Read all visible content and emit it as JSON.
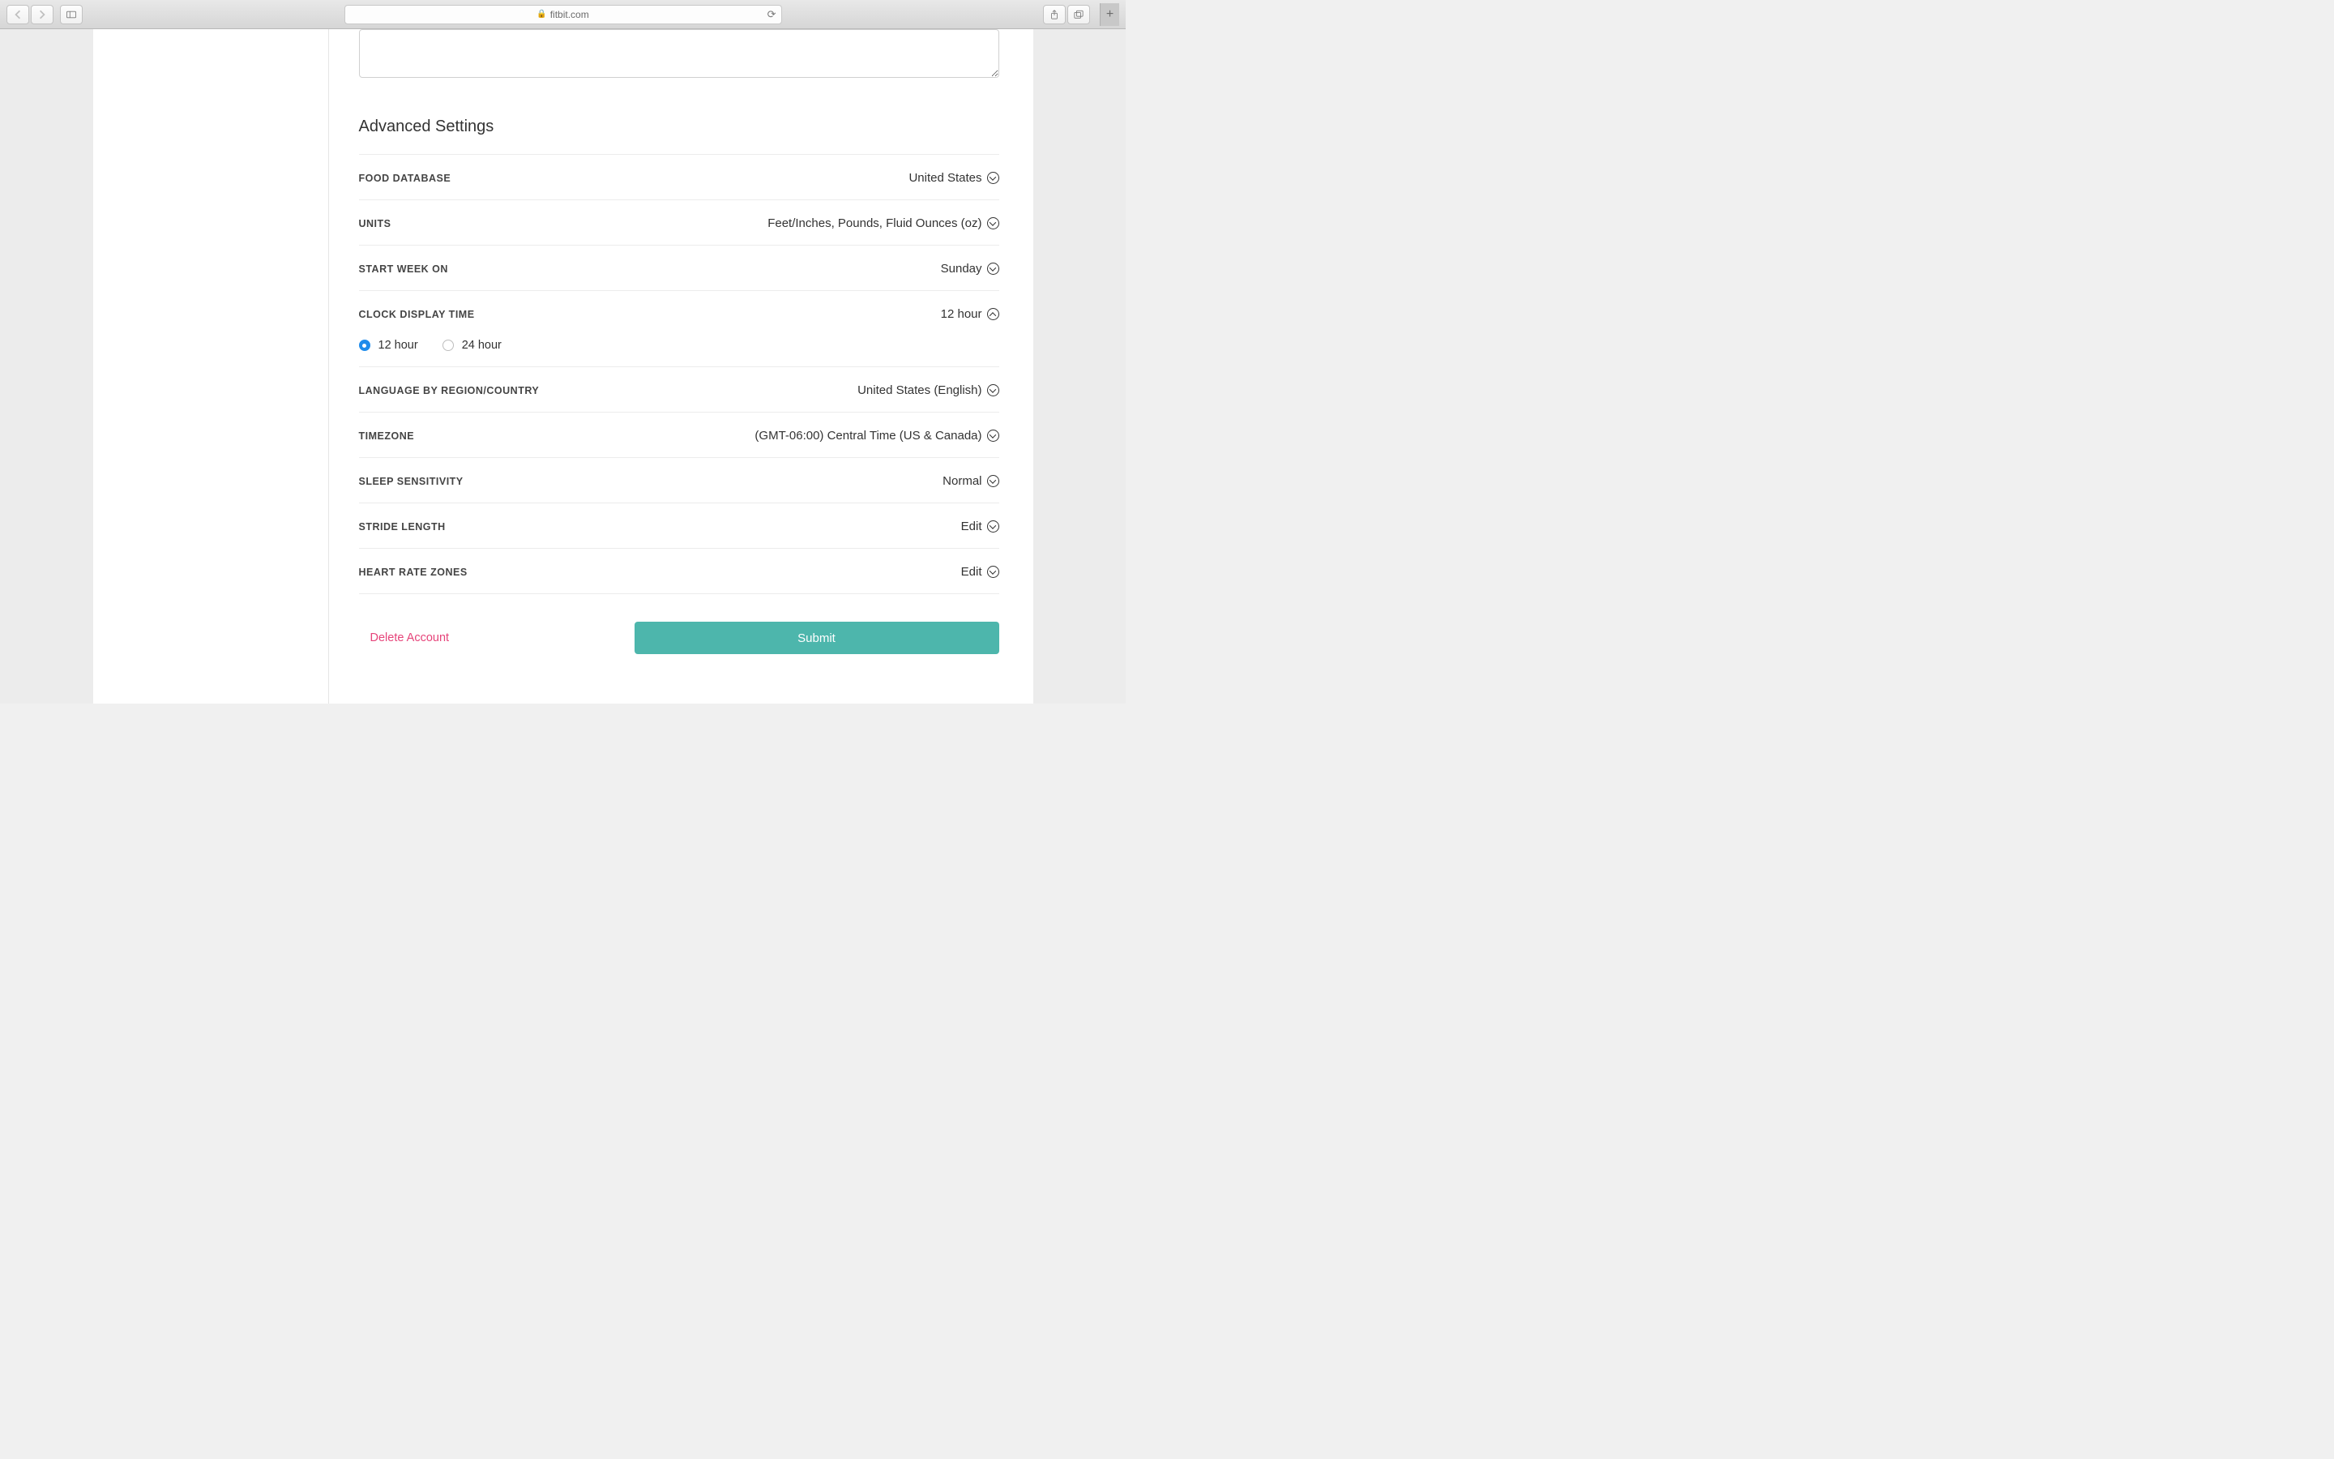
{
  "browser": {
    "url_host": "fitbit.com"
  },
  "settings": {
    "section_title": "Advanced Settings",
    "rows": {
      "food_db": {
        "label": "FOOD DATABASE",
        "value": "United States"
      },
      "units": {
        "label": "UNITS",
        "value": "Feet/Inches, Pounds, Fluid Ounces (oz)"
      },
      "start_week": {
        "label": "START WEEK ON",
        "value": "Sunday"
      },
      "clock": {
        "label": "CLOCK DISPLAY TIME",
        "value": "12 hour",
        "options": {
          "opt1": "12 hour",
          "opt2": "24 hour"
        }
      },
      "language": {
        "label": "LANGUAGE BY REGION/COUNTRY",
        "value": "United States (English)"
      },
      "timezone": {
        "label": "TIMEZONE",
        "value": "(GMT-06:00) Central Time (US & Canada)"
      },
      "sleep": {
        "label": "SLEEP SENSITIVITY",
        "value": "Normal"
      },
      "stride": {
        "label": "STRIDE LENGTH",
        "value": "Edit"
      },
      "hr_zones": {
        "label": "HEART RATE ZONES",
        "value": "Edit"
      }
    },
    "delete_label": "Delete Account",
    "submit_label": "Submit"
  }
}
